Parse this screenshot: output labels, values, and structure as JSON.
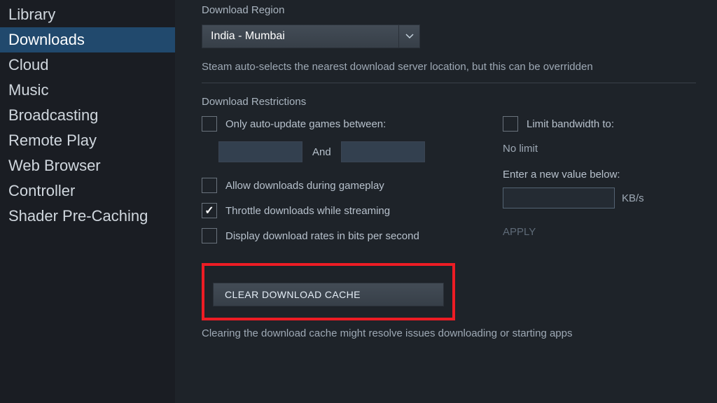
{
  "sidebar": {
    "items": [
      {
        "label": "Library"
      },
      {
        "label": "Downloads"
      },
      {
        "label": "Cloud"
      },
      {
        "label": "Music"
      },
      {
        "label": "Broadcasting"
      },
      {
        "label": "Remote Play"
      },
      {
        "label": "Web Browser"
      },
      {
        "label": "Controller"
      },
      {
        "label": "Shader Pre-Caching"
      }
    ],
    "selected_index": 1
  },
  "region": {
    "title": "Download Region",
    "value": "India - Mumbai",
    "help": "Steam auto-selects the nearest download server location, but this can be overridden"
  },
  "restrictions": {
    "title": "Download Restrictions",
    "auto_update": {
      "label": "Only auto-update games between:",
      "checked": false
    },
    "and_label": "And",
    "allow_gameplay": {
      "label": "Allow downloads during gameplay",
      "checked": false
    },
    "throttle_streaming": {
      "label": "Throttle downloads while streaming",
      "checked": true
    },
    "display_bits": {
      "label": "Display download rates in bits per second",
      "checked": false
    },
    "limit_bandwidth": {
      "label": "Limit bandwidth to:",
      "checked": false
    },
    "no_limit": "No limit",
    "enter_value": "Enter a new value below:",
    "unit": "KB/s",
    "apply": "APPLY"
  },
  "clear_cache": {
    "button": "CLEAR DOWNLOAD CACHE",
    "help": "Clearing the download cache might resolve issues downloading or starting apps"
  }
}
